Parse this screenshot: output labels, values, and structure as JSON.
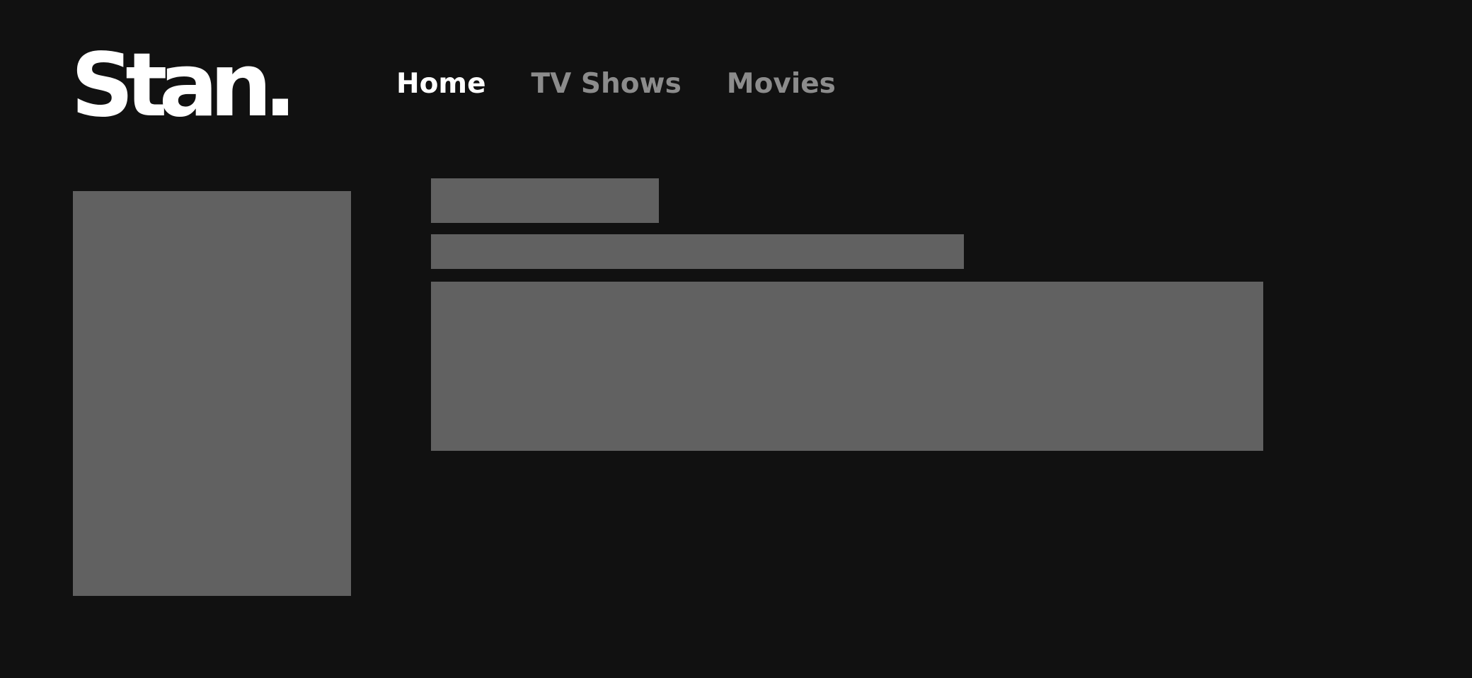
{
  "app": {
    "logo_text": "Stan.",
    "logo_color": "#ffffff",
    "background_color": "#111111"
  },
  "nav": {
    "items": [
      {
        "label": "Home",
        "active": true
      },
      {
        "label": "TV Shows",
        "active": false
      },
      {
        "label": "Movies",
        "active": false
      }
    ],
    "active_color": "#ffffff",
    "inactive_color": "#8c8c8c"
  },
  "placeholder": {
    "color": "#616161",
    "state": "loading skeleton"
  }
}
